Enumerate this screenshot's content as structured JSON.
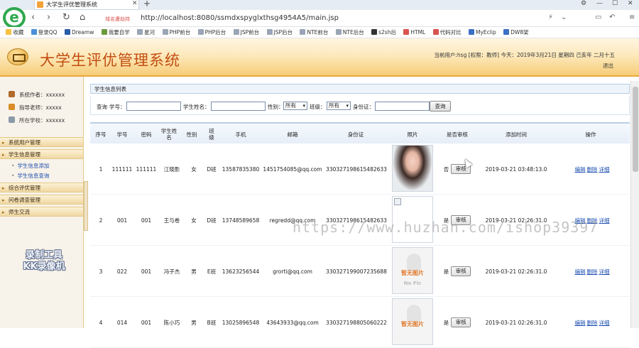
{
  "browser": {
    "tab_title": "大学生评优管理系统",
    "address_warning": "域名遭劫持",
    "url": "http://localhost:8080/ssmdxspyglxthsg4954A5/main.jsp",
    "bookmarks": [
      "收藏",
      "登录QQ",
      "Dreamw",
      "我要自学",
      "星河",
      "PHP前台",
      "PHP后台",
      "JSP前台",
      "JSP后台",
      "NTE前台",
      "NTE后台",
      "s2sh后",
      "HTML",
      "代码对比",
      "MyEclip",
      "DW8架"
    ]
  },
  "app": {
    "title": "大学生评优管理系统",
    "header_info": "当前用户:hsg [权限：教师] 今天：2019年3月21日 星期四 己亥年 二月十五",
    "exit": "退出"
  },
  "sidebar": {
    "info": [
      {
        "label": "系统作者：xxxxxx"
      },
      {
        "label": "指导老师：xxxxx"
      },
      {
        "label": "所在学校：xxxxxx"
      }
    ],
    "menu": {
      "user_mgmt": "系统用户管理",
      "student_mgmt": "学生信息管理",
      "student_add": "学生信息添加",
      "student_query": "学生信息查询",
      "eval_mgmt": "综合评优管理",
      "survey_mgmt": "问卷调查管理",
      "teacher_talk": "师生交流"
    },
    "recorder_watermark": [
      "录制工具",
      "KK录像机"
    ]
  },
  "panel": {
    "title": "学生信息列表",
    "search": {
      "label": "查询",
      "student_no": "学号：",
      "student_name": "学生姓名：",
      "gender": "性别：",
      "gender_value": "所有",
      "class": "班级：",
      "class_value": "所有",
      "id_card": "身份证：",
      "button": "查询"
    }
  },
  "table": {
    "headers": [
      "序号",
      "学号",
      "密码",
      "学生姓名",
      "性别",
      "班级",
      "手机",
      "邮箱",
      "身份证",
      "照片",
      "是否审核",
      "添加时间",
      "操作"
    ],
    "rows": [
      {
        "no": "1",
        "sno": "111111",
        "pwd": "111111",
        "name": "江晓影",
        "gender": "女",
        "cls": "D班",
        "phone": "13587835380",
        "email": "1451754085@qq.com",
        "idcard": "330327198615482633",
        "audit": "否",
        "audit_btn": "审核",
        "time": "2019-03-21 03:48:13.0",
        "edit": "编辑",
        "del": "删除",
        "detail": "详细"
      },
      {
        "no": "2",
        "sno": "001",
        "pwd": "001",
        "name": "王与卷",
        "gender": "女",
        "cls": "D班",
        "phone": "13748589658",
        "email": "regredd@qq.com",
        "idcard": "330327198615482633",
        "audit": "是",
        "audit_btn": "审核",
        "time": "2019-03-21 02:26:31.0",
        "edit": "编辑",
        "del": "删除",
        "detail": "详细"
      },
      {
        "no": "3",
        "sno": "022",
        "pwd": "001",
        "name": "冯子杰",
        "gender": "男",
        "cls": "E班",
        "phone": "13623256544",
        "email": "grorti@qq.com",
        "idcard": "330327199007235688",
        "audit": "是",
        "audit_btn": "审核",
        "time": "2019-03-21 02:26:31.0",
        "edit": "编辑",
        "del": "删除",
        "detail": "详细",
        "nophoto_cn": "暂无图片",
        "nophoto_en": "No Pic"
      },
      {
        "no": "4",
        "sno": "014",
        "pwd": "001",
        "name": "陈小巧",
        "gender": "男",
        "cls": "B班",
        "phone": "13025896548",
        "email": "43643933@qq.com",
        "idcard": "330327198805060222",
        "audit": "是",
        "audit_btn": "审核",
        "time": "2019-03-21 02:26:31.0",
        "edit": "编辑",
        "del": "删除",
        "detail": "详细",
        "nophoto_cn": "暂无图片"
      }
    ]
  },
  "watermark_url": "https://www.huzhan.com/ishop39397"
}
